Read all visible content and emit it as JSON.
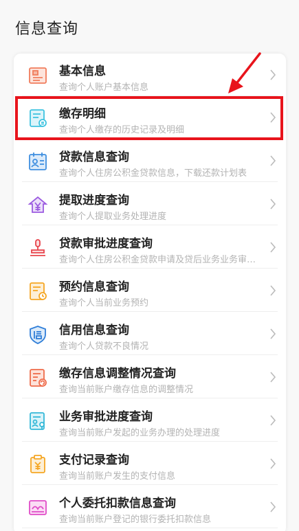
{
  "page": {
    "title": "信息查询"
  },
  "colors": {
    "highlight": "#e8141c",
    "title_text": "#222222",
    "subtitle_text": "#b3b3b3"
  },
  "items": [
    {
      "title": "基本信息",
      "subtitle": "查询个人账户基本信息",
      "icon": "id-card-icon",
      "color": "#f07c5c"
    },
    {
      "title": "缴存明细",
      "subtitle": "查询个人缴存的历史记录及明细",
      "icon": "deposit-doc-icon",
      "color": "#3ec3e0"
    },
    {
      "title": "贷款信息查询",
      "subtitle": "查询个人住房公积金贷款信息，下载还款计划表",
      "icon": "calendar-person-icon",
      "color": "#3f8fe0"
    },
    {
      "title": "提取进度查询",
      "subtitle": "查询个人提取业务处理进度",
      "icon": "house-yen-icon",
      "color": "#9b5ae0"
    },
    {
      "title": "贷款审批进度查询",
      "subtitle": "查询个人住房公积金贷款申请及贷后业务业务审批进度",
      "icon": "stamp-icon",
      "color": "#e8444c"
    },
    {
      "title": "预约信息查询",
      "subtitle": "查询个人当前业务预约",
      "icon": "clock-doc-icon",
      "color": "#f5a623"
    },
    {
      "title": "信用信息查询",
      "subtitle": "查询个人贷款不良情况",
      "icon": "credit-shield-icon",
      "color": "#2f7ed8"
    },
    {
      "title": "缴存信息调整情况查询",
      "subtitle": "查询当前账户缴存信息的调整情况",
      "icon": "adjust-doc-icon",
      "color": "#ef6b4a"
    },
    {
      "title": "业务审批进度查询",
      "subtitle": "查询当前账户发起的业务办理的处理进度",
      "icon": "approval-doc-icon",
      "color": "#34b8d8"
    },
    {
      "title": "支付记录查询",
      "subtitle": "查询当前账户发生的支付信息",
      "icon": "payment-record-icon",
      "color": "#f5a623"
    },
    {
      "title": "个人委托扣款信息查询",
      "subtitle": "查询当前账户登记的银行委托扣款信息",
      "icon": "entrust-card-icon",
      "color": "#e04cc8"
    }
  ]
}
